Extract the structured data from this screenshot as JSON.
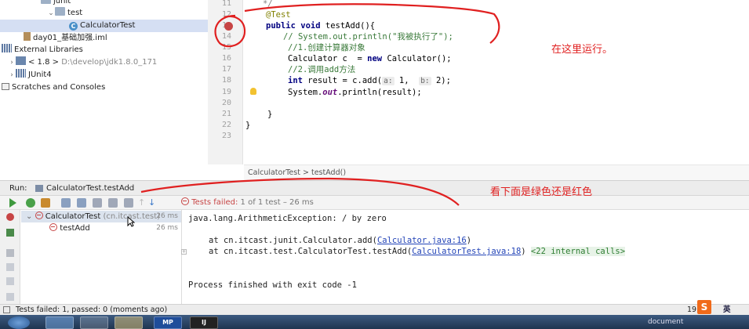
{
  "project_tree": {
    "items": [
      {
        "label": "junit",
        "extra": ""
      },
      {
        "label": "test",
        "extra": ""
      },
      {
        "label": "CalculatorTest",
        "extra": ""
      },
      {
        "label": "day01_基础加强.iml",
        "extra": ""
      },
      {
        "label": "External Libraries",
        "extra": ""
      },
      {
        "label": "< 1.8 >",
        "extra": "D:\\develop\\jdk1.8.0_171"
      },
      {
        "label": "JUnit4",
        "extra": ""
      },
      {
        "label": "Scratches and Consoles",
        "extra": ""
      }
    ]
  },
  "editor": {
    "line_numbers": [
      "11",
      "12",
      "13",
      "14",
      "15",
      "16",
      "17",
      "18",
      "19",
      "20",
      "21",
      "22",
      "23"
    ],
    "code": {
      "l11": "*/",
      "l12_ann": "@Test",
      "l13_kw1": "public",
      "l13_kw2": "void",
      "l13_rest": "testAdd(){",
      "l14": "// System.out.println(\"我被执行了\");",
      "l15": "//1.创建计算器对象",
      "l16_a": "Calculator c  = ",
      "l16_kw": "new",
      "l16_b": " Calculator();",
      "l17": "//2.调用add方法",
      "l18_kw": "int",
      "l18_a": " result = c.add(",
      "l18_h1": "a:",
      "l18_b": " 1,  ",
      "l18_h2": "b:",
      "l18_c": " 2);",
      "l19_a": "System.",
      "l19_out": "out",
      "l19_b": ".println(result);",
      "l21": "}",
      "l22": "}"
    },
    "breadcrumb": {
      "class": "CalculatorTest",
      "sep": ">",
      "method": "testAdd()"
    }
  },
  "run_panel": {
    "label": "Run:",
    "tab": "CalculatorTest.testAdd",
    "close": "×",
    "status_prefix": "Tests failed:",
    "status_detail": "1 of 1 test – 26 ms",
    "tree": [
      {
        "label": "CalculatorTest",
        "pkg": "(cn.itcast.test)",
        "time": "26 ms"
      },
      {
        "label": "testAdd",
        "pkg": "",
        "time": "26 ms"
      }
    ],
    "console": {
      "exception": "java.lang.ArithmeticException: / by zero",
      "trace1_pre": "at cn.itcast.junit.Calculator.add(",
      "trace1_link": "Calculator.java:16",
      "trace1_post": ")",
      "trace2_pre": "at cn.itcast.test.CalculatorTest.testAdd(",
      "trace2_link": "CalculatorTest.java:18",
      "trace2_post": ")",
      "internal_calls": "<22 internal calls>",
      "exit": "Process finished with exit code -1"
    }
  },
  "status_bar": {
    "text": "Tests failed: 1, passed: 0 (moments ago)",
    "right_num": "19",
    "ime": "英"
  },
  "taskbar": {
    "apps": [
      "MP",
      "IJ"
    ],
    "right_text": "document"
  },
  "annotations": {
    "run_here": "在这里运行。",
    "check_color": "看下面是绿色还是红色"
  },
  "colors": {
    "annotation": "#e02020",
    "fail": "#c74545",
    "pass": "#3f9a3f"
  }
}
